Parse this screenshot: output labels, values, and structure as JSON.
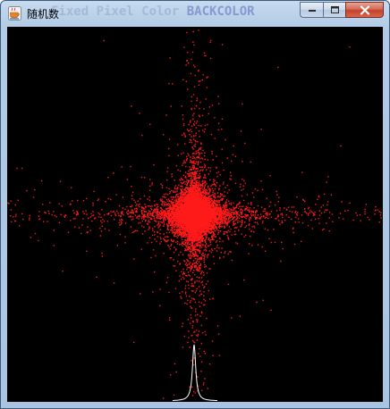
{
  "window": {
    "title": "随机数",
    "ghost_text_plain": "Fixed Pixel Color ",
    "ghost_text_strong": "BACKCOLOR"
  },
  "icons": {
    "app": "java-coffee-cup-icon",
    "minimize": "minimize-icon",
    "maximize": "maximize-icon",
    "close": "close-icon"
  },
  "colors": {
    "canvas_background": "#000000",
    "points": "#ff1a1a",
    "curve": "#ffffff",
    "titlebar": "#b9d1ea",
    "close_button": "#c94a33"
  },
  "plot": {
    "point_distribution": "Cauchy-like cross of random points",
    "histogram_peak_height": 0.15
  }
}
